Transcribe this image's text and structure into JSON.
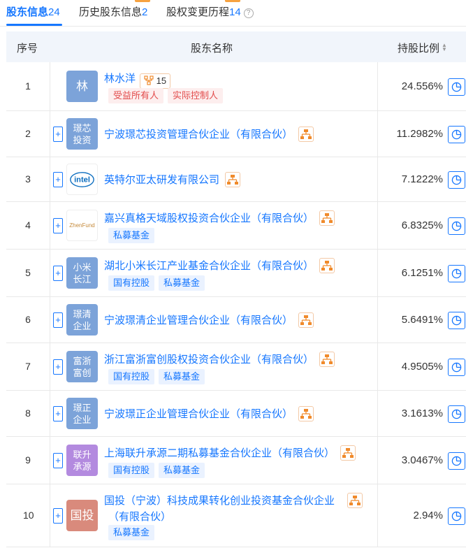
{
  "tabs": [
    {
      "label": "股东信息",
      "count": "24",
      "active": true
    },
    {
      "label": "历史股东信息",
      "count": "2"
    },
    {
      "label": "股权变更历程",
      "count": "14"
    }
  ],
  "table": {
    "headers": {
      "index": "序号",
      "name": "股东名称",
      "ratio": "持股比例"
    },
    "rows": [
      {
        "index": "1",
        "logo_text": "林",
        "name": "林水洋",
        "ctrl_count": "15",
        "tags": [
          "受益所有人",
          "实际控制人"
        ],
        "ratio": "24.556%"
      },
      {
        "index": "2",
        "logo_text": "璟芯\n投资",
        "name": "宁波璟芯投资管理合伙企业（有限合伙）",
        "tags": [],
        "ratio": "11.2982%"
      },
      {
        "index": "3",
        "logo_text": "intel",
        "name": "英特尔亚太研发有限公司",
        "tags": [],
        "ratio": "7.1222%"
      },
      {
        "index": "4",
        "logo_text": "ZhenFund",
        "name": "嘉兴真格天域股权投资合伙企业（有限合伙）",
        "tags": [
          "私募基金"
        ],
        "ratio": "6.8325%"
      },
      {
        "index": "5",
        "logo_text": "小米\n长江",
        "name": "湖北小米长江产业基金合伙企业（有限合伙）",
        "tags": [
          "国有控股",
          "私募基金"
        ],
        "ratio": "6.1251%"
      },
      {
        "index": "6",
        "logo_text": "璟清\n企业",
        "name": "宁波璟清企业管理合伙企业（有限合伙）",
        "tags": [],
        "ratio": "5.6491%"
      },
      {
        "index": "7",
        "logo_text": "富浙\n富创",
        "name": "浙江富浙富创股权投资合伙企业（有限合伙）",
        "tags": [
          "国有控股",
          "私募基金"
        ],
        "ratio": "4.9505%"
      },
      {
        "index": "8",
        "logo_text": "璟正\n企业",
        "name": "宁波璟正企业管理合伙企业（有限合伙）",
        "tags": [],
        "ratio": "3.1613%"
      },
      {
        "index": "9",
        "logo_text": "联升\n承源",
        "name": "上海联升承源二期私募基金合伙企业（有限合伙）",
        "tags": [
          "国有控股",
          "私募基金"
        ],
        "ratio": "3.0467%"
      },
      {
        "index": "10",
        "logo_text": "国投",
        "name": "国投（宁波）科技成果转化创业投资基金合伙企业",
        "name_line2": "（有限合伙）",
        "tags": [
          "私募基金"
        ],
        "ratio": "2.94%"
      }
    ]
  },
  "colors": {
    "accent": "#1677ff",
    "logo_blue": "#7ca3d9",
    "logo_purple": "#b38adf",
    "logo_red": "#d98a7c",
    "struct_orange": "#f08a2b"
  },
  "icons": [
    "help-circle-icon",
    "sort-icon",
    "expand-plus-icon",
    "equity-structure-icon",
    "pie-chart-icon",
    "controller-icon"
  ]
}
